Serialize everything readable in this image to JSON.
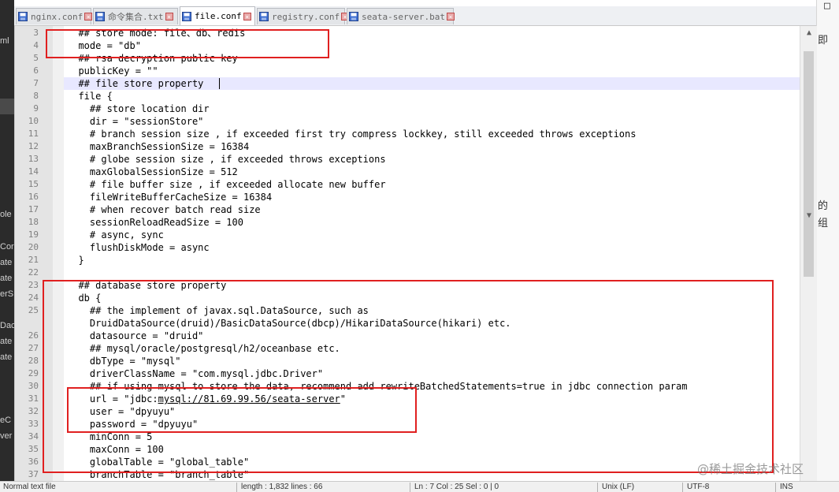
{
  "tabs": [
    {
      "label": "nginx.conf",
      "active": false
    },
    {
      "label": "命令集合.txt",
      "active": false
    },
    {
      "label": "file.conf",
      "active": true
    },
    {
      "label": "registry.conf",
      "active": false
    },
    {
      "label": "seata-server.bat",
      "active": false
    }
  ],
  "editor": {
    "lines": [
      {
        "num": "3",
        "text": "  ## store mode: file、db、redis"
      },
      {
        "num": "4",
        "text": "  mode = \"db\""
      },
      {
        "num": "5",
        "text": "  ## rsa decryption public key"
      },
      {
        "num": "6",
        "text": "  publicKey = \"\""
      },
      {
        "num": "7",
        "text": "  ## file store property"
      },
      {
        "num": "8",
        "text": "  file {"
      },
      {
        "num": "9",
        "text": "    ## store location dir"
      },
      {
        "num": "10",
        "text": "    dir = \"sessionStore\""
      },
      {
        "num": "11",
        "text": "    # branch session size , if exceeded first try compress lockkey, still exceeded throws exceptions"
      },
      {
        "num": "12",
        "text": "    maxBranchSessionSize = 16384"
      },
      {
        "num": "13",
        "text": "    # globe session size , if exceeded throws exceptions"
      },
      {
        "num": "14",
        "text": "    maxGlobalSessionSize = 512"
      },
      {
        "num": "15",
        "text": "    # file buffer size , if exceeded allocate new buffer"
      },
      {
        "num": "16",
        "text": "    fileWriteBufferCacheSize = 16384"
      },
      {
        "num": "17",
        "text": "    # when recover batch read size"
      },
      {
        "num": "18",
        "text": "    sessionReloadReadSize = 100"
      },
      {
        "num": "19",
        "text": "    # async, sync"
      },
      {
        "num": "20",
        "text": "    flushDiskMode = async"
      },
      {
        "num": "21",
        "text": "  }"
      },
      {
        "num": "22",
        "text": ""
      },
      {
        "num": "23",
        "text": "  ## database store property"
      },
      {
        "num": "24",
        "text": "  db {"
      },
      {
        "num": "25",
        "text": "    ## the implement of javax.sql.DataSource, such as"
      },
      {
        "num": "",
        "text": "    DruidDataSource(druid)/BasicDataSource(dbcp)/HikariDataSource(hikari) etc."
      },
      {
        "num": "26",
        "text": "    datasource = \"druid\""
      },
      {
        "num": "27",
        "text": "    ## mysql/oracle/postgresql/h2/oceanbase etc."
      },
      {
        "num": "28",
        "text": "    dbType = \"mysql\""
      },
      {
        "num": "29",
        "text": "    driverClassName = \"com.mysql.jdbc.Driver\""
      },
      {
        "num": "30",
        "text": "    ## if using mysql to store the data, recommend add rewriteBatchedStatements=true in jdbc connection param"
      },
      {
        "num": "31",
        "text": "    url = \"jdbc:mysql://81.69.99.56/seata-server\""
      },
      {
        "num": "32",
        "text": "    user = \"dpyuyu\""
      },
      {
        "num": "33",
        "text": "    password = \"dpyuyu\""
      },
      {
        "num": "34",
        "text": "    minConn = 5"
      },
      {
        "num": "35",
        "text": "    maxConn = 100"
      },
      {
        "num": "36",
        "text": "    globalTable = \"global_table\""
      },
      {
        "num": "37",
        "text": "    branchTable = \"branch_table\""
      }
    ]
  },
  "statusbar": {
    "type": "Normal text file",
    "length": "length : 1,832    lines : 66",
    "position": "Ln : 7    Col : 25    Sel : 0 | 0",
    "eol": "Unix (LF)",
    "encoding": "UTF-8",
    "mode": "INS"
  },
  "left_fragments": [
    "ml",
    "ole",
    "Cor",
    "ate",
    "ate",
    "erS",
    "Dac",
    "ate",
    "ate",
    "eC",
    "ver"
  ],
  "right_fragments": [
    "即",
    "的",
    "组"
  ],
  "watermark": "@稀土掘金技术社区",
  "colors": {
    "annotation": "#e02020",
    "current_line": "#e8e8ff",
    "gutter": "#e4e4e4"
  }
}
